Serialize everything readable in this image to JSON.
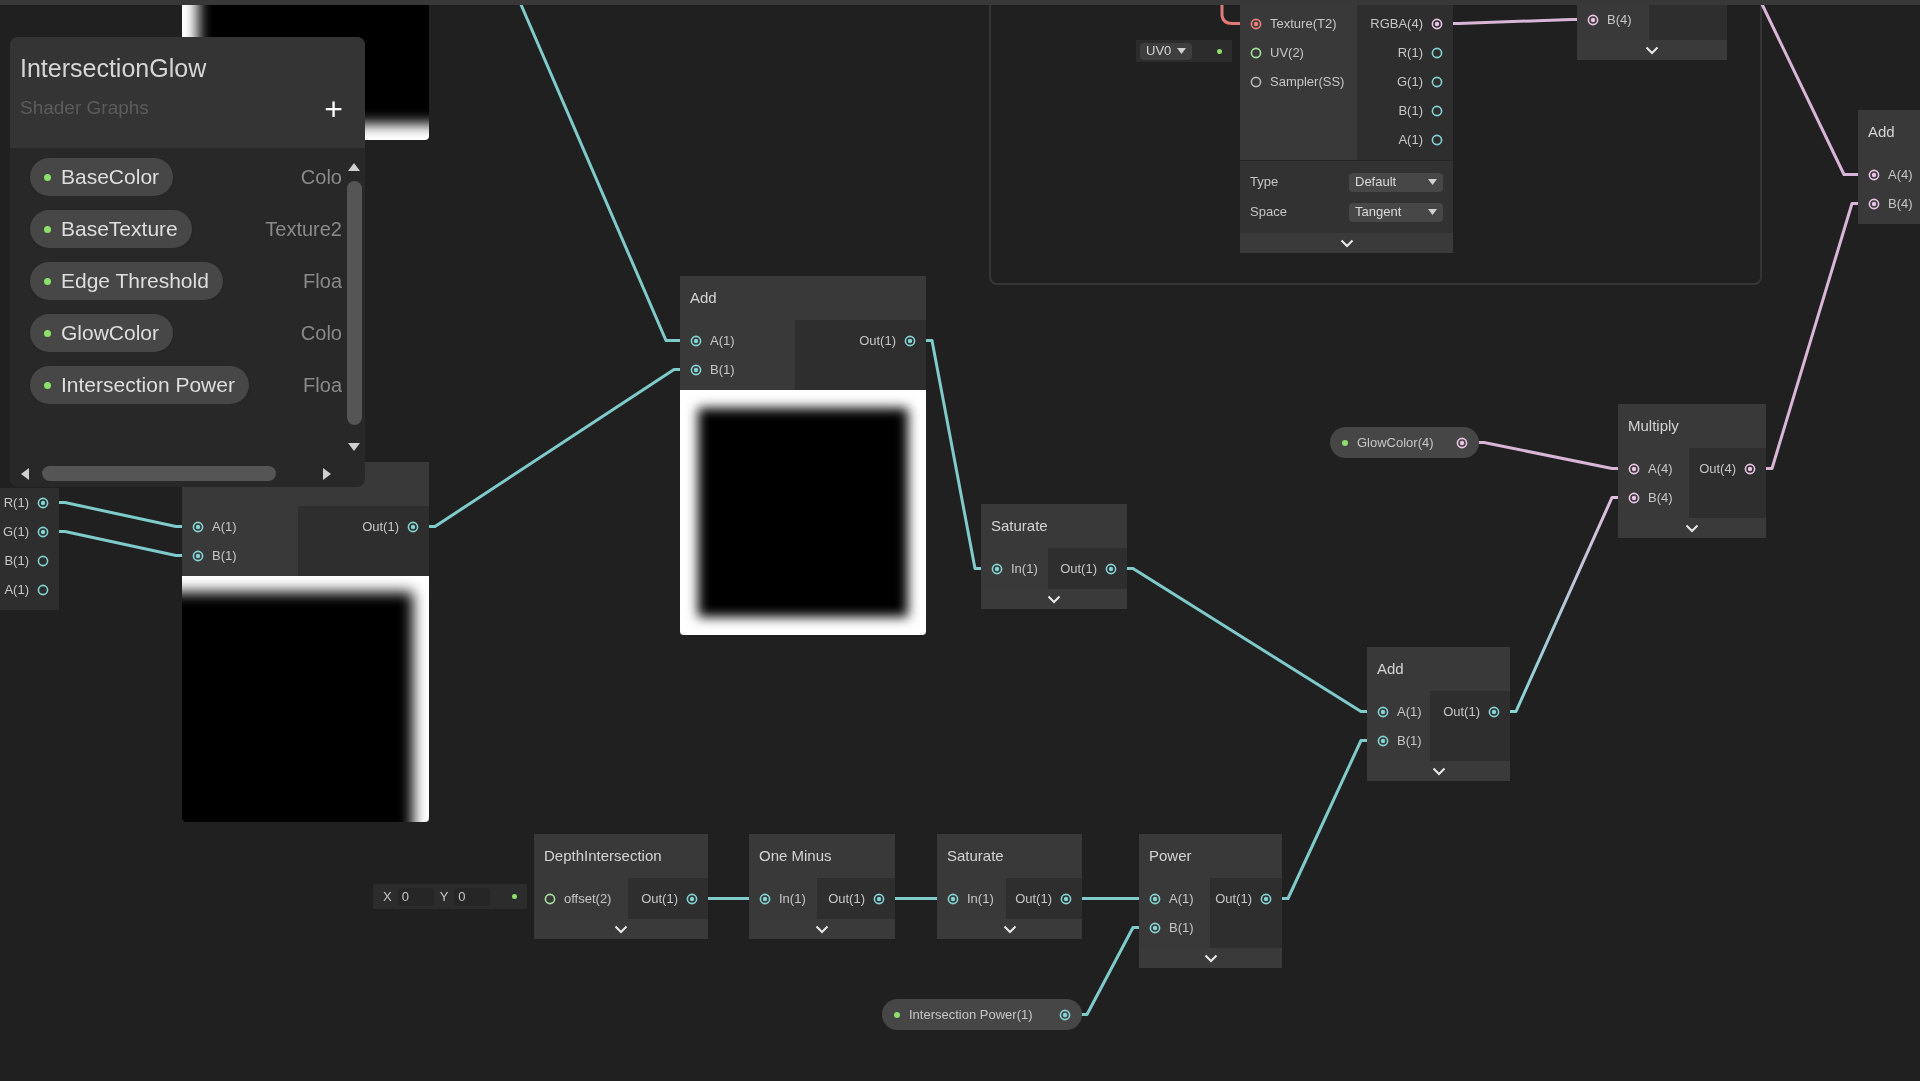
{
  "blackboard": {
    "title": "IntersectionGlow",
    "subtitle": "Shader Graphs",
    "add_label": "+",
    "properties": [
      {
        "name": "BaseColor",
        "type": "Colo"
      },
      {
        "name": "BaseTexture",
        "type": "Texture2"
      },
      {
        "name": "Edge Threshold",
        "type": "Floa"
      },
      {
        "name": "GlowColor",
        "type": "Colo"
      },
      {
        "name": "Intersection Power",
        "type": "Floa"
      }
    ]
  },
  "nodes": [
    {
      "outputs": [
        {
          "label": "R(1)",
          "color": "#84d4d4",
          "connected": true
        },
        {
          "label": "G(1)",
          "color": "#84d4d4",
          "connected": true
        },
        {
          "label": "B(1)",
          "color": "#84d4d4",
          "connected": false
        },
        {
          "label": "A(1)",
          "color": "#84d4d4",
          "connected": false
        }
      ]
    },
    {
      "preview": true
    },
    {
      "inputs": [
        {
          "label": "A(1)",
          "color": "#84d4d4",
          "connected": true
        },
        {
          "label": "B(1)",
          "color": "#84d4d4",
          "connected": true
        }
      ],
      "outputs": [
        {
          "label": "Out(1)",
          "color": "#84d4d4",
          "connected": true
        }
      ],
      "preview": true
    },
    {
      "title": "Add",
      "inputs": [
        {
          "label": "A(1)",
          "color": "#84d4d4",
          "connected": true
        },
        {
          "label": "B(1)",
          "color": "#84d4d4",
          "connected": true
        }
      ],
      "outputs": [
        {
          "label": "Out(1)",
          "color": "#84d4d4",
          "connected": true
        }
      ],
      "preview": true
    },
    {
      "inputs": [
        {
          "label": "Texture(T2)",
          "color": "#ef7f7f",
          "connected": true
        },
        {
          "label": "UV(2)",
          "color": "#a6e3a0",
          "connected": false
        },
        {
          "label": "Sampler(SS)",
          "color": "#b8b8b8",
          "connected": false
        }
      ],
      "outputs": [
        {
          "label": "RGBA(4)",
          "color": "#e8c4e6",
          "connected": true
        },
        {
          "label": "R(1)",
          "color": "#84d4d4",
          "connected": false
        },
        {
          "label": "G(1)",
          "color": "#84d4d4",
          "connected": false
        },
        {
          "label": "B(1)",
          "color": "#84d4d4",
          "connected": false
        },
        {
          "label": "A(1)",
          "color": "#84d4d4",
          "connected": false
        }
      ],
      "settings": [
        {
          "label": "Type",
          "value": "Default"
        },
        {
          "label": "Space",
          "value": "Tangent"
        }
      ],
      "expandable": true
    },
    {
      "inputs": [
        {
          "label": "B(4)",
          "color": "#e8c4e6",
          "connected": true
        }
      ],
      "expandable": true
    },
    {
      "title": "Add",
      "inputs": [
        {
          "label": "A(4)",
          "color": "#e8c4e6",
          "connected": true
        },
        {
          "label": "B(4)",
          "color": "#e8c4e6",
          "connected": true
        }
      ]
    },
    {
      "title": "Saturate",
      "inputs": [
        {
          "label": "In(1)",
          "color": "#84d4d4",
          "connected": true
        }
      ],
      "outputs": [
        {
          "label": "Out(1)",
          "color": "#84d4d4",
          "connected": true
        }
      ],
      "expandable": true
    },
    {
      "title": "Multiply",
      "inputs": [
        {
          "label": "A(4)",
          "color": "#e8c4e6",
          "connected": true
        },
        {
          "label": "B(4)",
          "color": "#e8c4e6",
          "connected": true
        }
      ],
      "outputs": [
        {
          "label": "Out(4)",
          "color": "#e8c4e6",
          "connected": true
        }
      ],
      "expandable": true
    },
    {
      "title": "Add",
      "inputs": [
        {
          "label": "A(1)",
          "color": "#84d4d4",
          "connected": true
        },
        {
          "label": "B(1)",
          "color": "#84d4d4",
          "connected": true
        }
      ],
      "outputs": [
        {
          "label": "Out(1)",
          "color": "#84d4d4",
          "connected": true
        }
      ],
      "expandable": true
    },
    {
      "title": "DepthIntersection",
      "inputs": [
        {
          "label": "offset(2)",
          "color": "#a6e3a0",
          "connected": false
        }
      ],
      "outputs": [
        {
          "label": "Out(1)",
          "color": "#84d4d4",
          "connected": true
        }
      ],
      "expandable": true
    },
    {
      "title": "One Minus",
      "inputs": [
        {
          "label": "In(1)",
          "color": "#84d4d4",
          "connected": true
        }
      ],
      "outputs": [
        {
          "label": "Out(1)",
          "color": "#84d4d4",
          "connected": true
        }
      ],
      "expandable": true
    },
    {
      "title": "Saturate",
      "inputs": [
        {
          "label": "In(1)",
          "color": "#84d4d4",
          "connected": true
        }
      ],
      "outputs": [
        {
          "label": "Out(1)",
          "color": "#84d4d4",
          "connected": true
        }
      ],
      "expandable": true
    },
    {
      "title": "Power",
      "inputs": [
        {
          "label": "A(1)",
          "color": "#84d4d4",
          "connected": true
        },
        {
          "label": "B(1)",
          "color": "#84d4d4",
          "connected": true
        }
      ],
      "outputs": [
        {
          "label": "Out(1)",
          "color": "#84d4d4",
          "connected": true
        }
      ],
      "expandable": true
    }
  ],
  "property_nodes": [
    {
      "label": "GlowColor(4)",
      "port": {
        "color": "#e8c4e6",
        "connected": true
      }
    },
    {
      "label": "Intersection Power(1)",
      "port": {
        "color": "#84d4d4",
        "connected": true
      }
    }
  ],
  "uv_input": {
    "value": "UV0"
  },
  "vector_input": {
    "x_label": "X",
    "x_value": "0",
    "y_label": "Y",
    "y_value": "0"
  }
}
